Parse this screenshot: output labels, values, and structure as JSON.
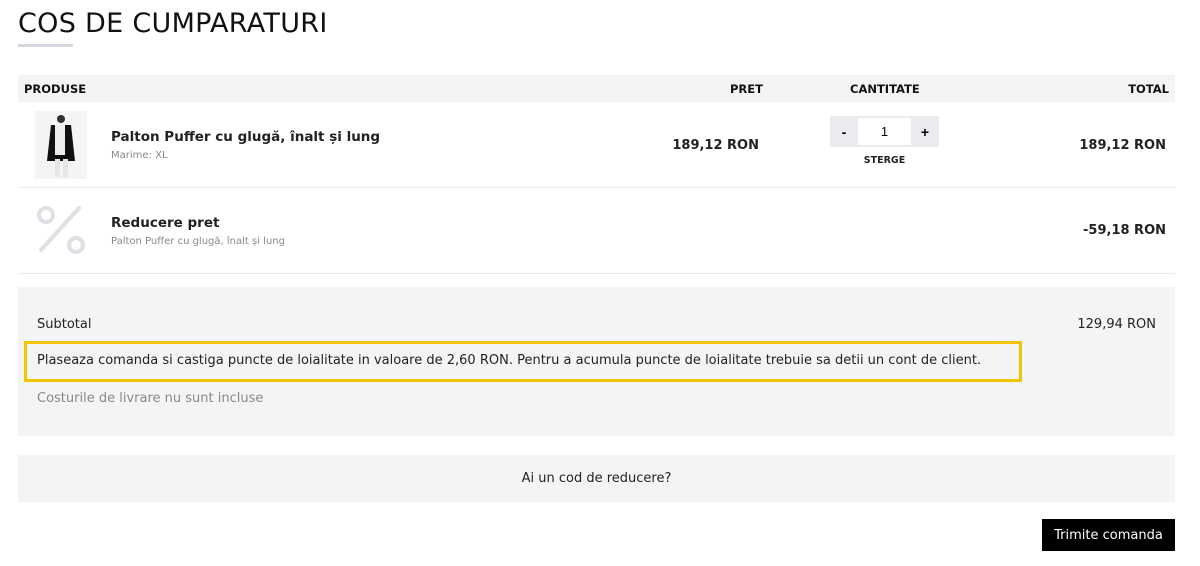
{
  "page_title": "COS DE CUMPARATURI",
  "table": {
    "headers": {
      "products": "PRODUSE",
      "price": "PRET",
      "quantity": "CANTITATE",
      "total": "TOTAL"
    }
  },
  "items": [
    {
      "name": "Palton Puffer cu glugă, înalt și lung",
      "detail": "Marime: XL",
      "price": "189,12 RON",
      "quantity": "1",
      "minus": "-",
      "plus": "+",
      "remove": "STERGE",
      "total": "189,12 RON"
    },
    {
      "name": "Reducere pret",
      "detail": "Palton Puffer cu glugă, înalt și lung",
      "total": "-59,18 RON"
    }
  ],
  "summary": {
    "subtotal_label": "Subtotal",
    "subtotal_value": "129,94 RON",
    "loyalty_note": "Plaseaza comanda si castiga puncte de loialitate in valoare de 2,60 RON. Pentru a acumula puncte de loialitate trebuie sa detii un cont de client.",
    "shipping_note": "Costurile de livrare nu sunt incluse"
  },
  "coupon_label": "Ai un cod de reducere?",
  "submit_label": "Trimite comanda",
  "colors": {
    "highlight": "#f2c500",
    "panel": "#f3f4f6",
    "button": "#000000"
  }
}
